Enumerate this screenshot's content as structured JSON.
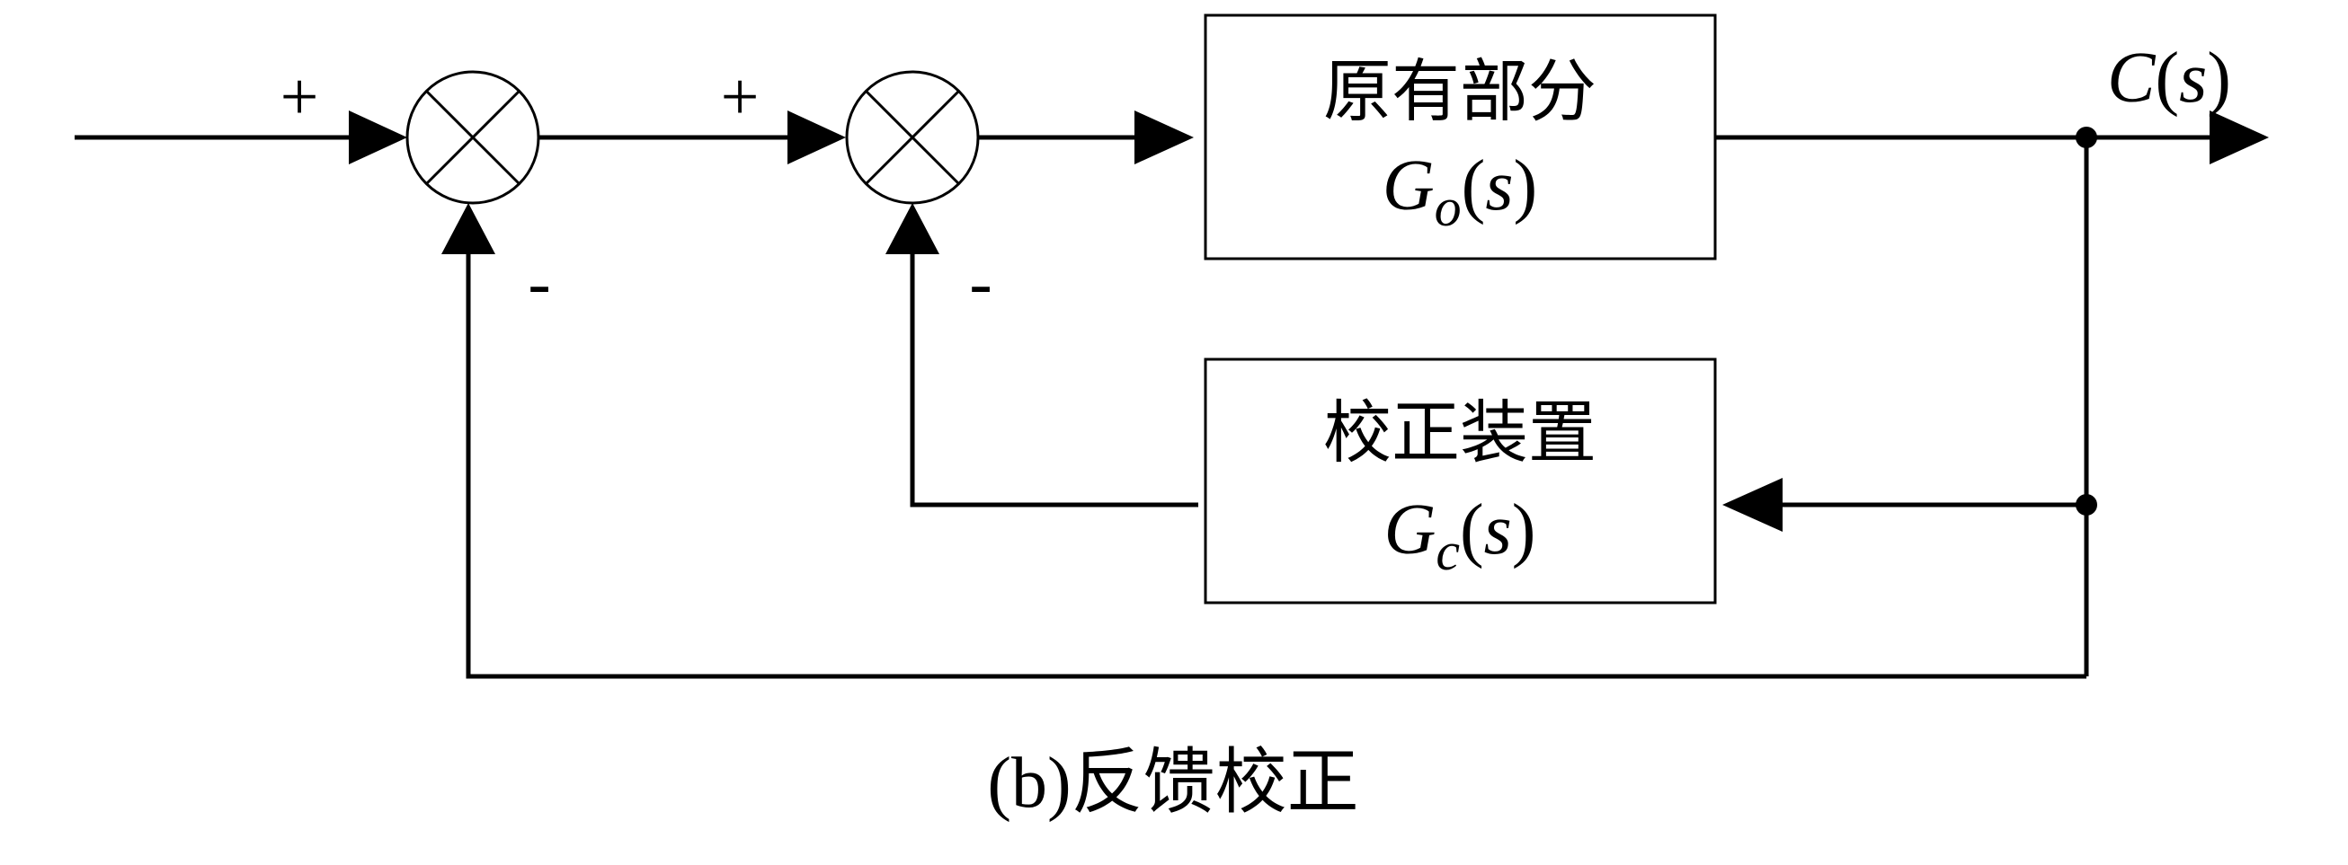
{
  "labels": {
    "plus": "+",
    "minus": "-",
    "output": "C(s)",
    "output_var": "C",
    "output_arg": "s"
  },
  "blocks": {
    "plant": {
      "title": "原有部分",
      "func": "G",
      "sub": "o",
      "arg": "s"
    },
    "compensator": {
      "title": "校正装置",
      "func": "G",
      "sub": "c",
      "arg": "s"
    }
  },
  "caption": "(b)反馈校正",
  "colors": {
    "line": "#000000",
    "background": "#ffffff"
  }
}
